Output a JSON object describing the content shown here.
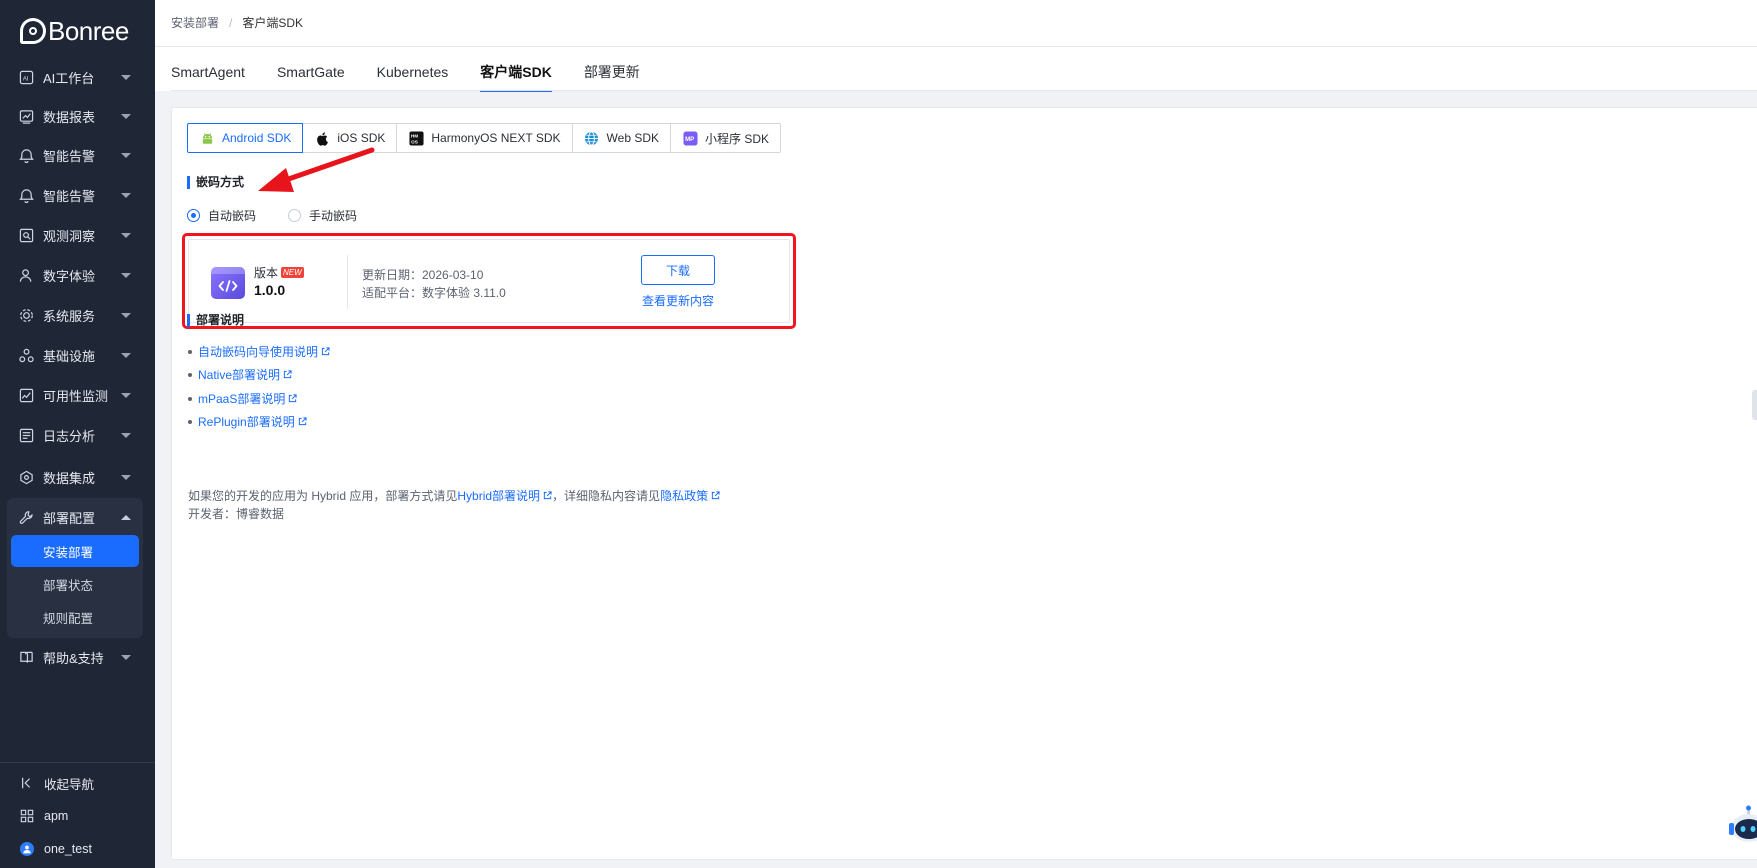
{
  "app": {
    "logo_text": "Bonree"
  },
  "sidebar": {
    "items": [
      {
        "label": "AI工作台",
        "icon": "ai-icon"
      },
      {
        "label": "数据报表",
        "icon": "report-icon"
      },
      {
        "label": "智能告警",
        "icon": "alert-icon"
      },
      {
        "label": "智能告警",
        "icon": "alert-icon"
      },
      {
        "label": "观测洞察",
        "icon": "insight-icon"
      },
      {
        "label": "数字体验",
        "icon": "user-experience-icon"
      },
      {
        "label": "系统服务",
        "icon": "service-icon"
      },
      {
        "label": "基础设施",
        "icon": "infrastructure-icon"
      },
      {
        "label": "可用性监测",
        "icon": "availability-icon"
      },
      {
        "label": "日志分析",
        "icon": "log-icon"
      },
      {
        "label": "数据集成",
        "icon": "integration-icon"
      },
      {
        "label": "部署配置",
        "icon": "wrench-icon",
        "expanded": true
      },
      {
        "label": "帮助&支持",
        "icon": "help-book-icon"
      }
    ],
    "sub_items": [
      {
        "label": "安装部署",
        "active": true
      },
      {
        "label": "部署状态",
        "active": false
      },
      {
        "label": "规则配置",
        "active": false
      }
    ],
    "bottom": {
      "collapse_label": "收起导航",
      "workspace_label": "apm",
      "user_label": "one_test"
    }
  },
  "breadcrumb": {
    "parent": "安装部署",
    "separator": "/",
    "current": "客户端SDK"
  },
  "tabs": [
    {
      "label": "SmartAgent",
      "active": false
    },
    {
      "label": "SmartGate",
      "active": false
    },
    {
      "label": "Kubernetes",
      "active": false
    },
    {
      "label": "客户端SDK",
      "active": true
    },
    {
      "label": "部署更新",
      "active": false
    }
  ],
  "sdk_tabs": [
    {
      "label": "Android SDK",
      "icon": "android-icon",
      "active": true
    },
    {
      "label": "iOS SDK",
      "icon": "apple-icon",
      "active": false
    },
    {
      "label": "HarmonyOS NEXT SDK",
      "icon": "harmonyos-icon",
      "active": false
    },
    {
      "label": "Web SDK",
      "icon": "globe-icon",
      "active": false
    },
    {
      "label": "小程序 SDK",
      "icon": "miniprogram-icon",
      "active": false
    }
  ],
  "embed": {
    "title": "嵌码方式",
    "options": [
      {
        "label": "自动嵌码",
        "checked": true
      },
      {
        "label": "手动嵌码",
        "checked": false
      }
    ]
  },
  "version_card": {
    "label": "版本",
    "badge": "NEW",
    "version": "1.0.0",
    "update_date": "更新日期：2026-03-10",
    "platform": "适配平台：数字体验 3.11.0",
    "download_label": "下载",
    "changelog_label": "查看更新内容"
  },
  "deploy_docs": {
    "title": "部署说明",
    "links": [
      "自动嵌码向导使用说明",
      "Native部署说明",
      "mPaaS部署说明",
      "RePlugin部署说明"
    ],
    "note_prefix": "如果您的开发的应用为 Hybrid 应用，部署方式请见",
    "note_link1": "Hybrid部署说明",
    "note_middle": "，详细隐私内容请见",
    "note_link2": "隐私政策",
    "developer": "开发者：博睿数据"
  },
  "colors": {
    "sidebar_bg": "#1f2636",
    "accent": "#1a6cff",
    "highlight_red": "#f1151d",
    "badge_red": "#f0433a"
  }
}
